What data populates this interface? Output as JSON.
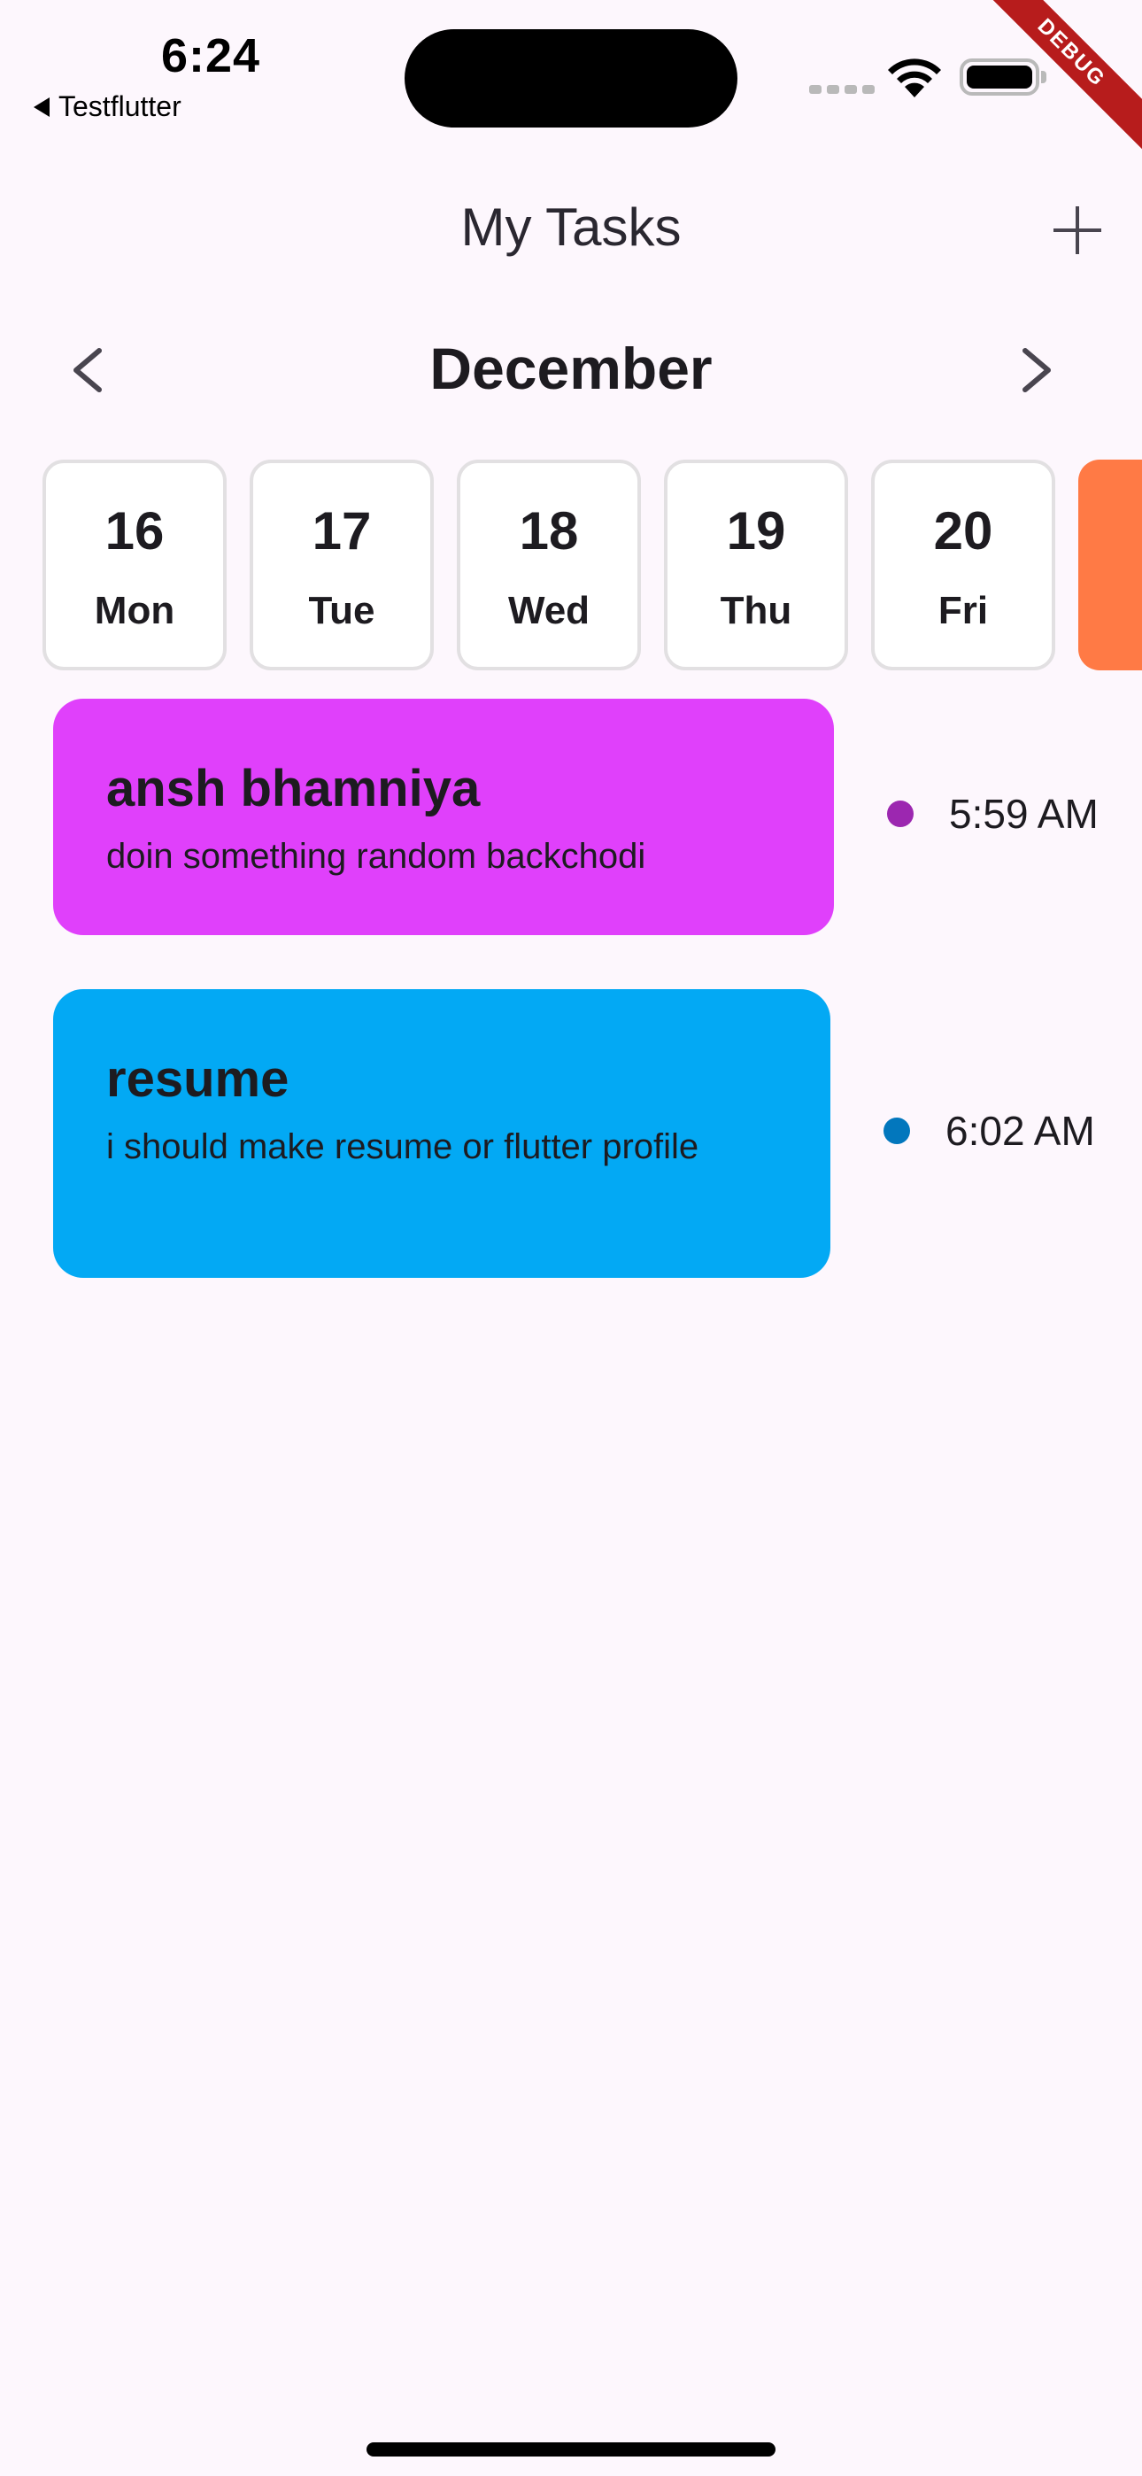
{
  "status_bar": {
    "time": "6:24",
    "back_app": "Testflutter",
    "debug_label": "DEBUG"
  },
  "header": {
    "title": "My Tasks",
    "add_icon": "plus-icon"
  },
  "calendar": {
    "month": "December",
    "prev_icon": "chevron-left-icon",
    "next_icon": "chevron-right-icon",
    "days": [
      {
        "num": "16",
        "dow": "Mon"
      },
      {
        "num": "17",
        "dow": "Tue"
      },
      {
        "num": "18",
        "dow": "Wed"
      },
      {
        "num": "19",
        "dow": "Thu"
      },
      {
        "num": "20",
        "dow": "Fri"
      }
    ],
    "selected_color": "#ff7a45"
  },
  "tasks": [
    {
      "title": "ansh bhamniya",
      "description": "doin something random backchodi",
      "time": "5:59 AM",
      "card_color": "#e040fb",
      "dot_color": "#9c27b0"
    },
    {
      "title": "resume",
      "description": "i should make resume or flutter profile",
      "time": "6:02 AM",
      "card_color": "#03a9f4",
      "dot_color": "#0277bd"
    }
  ]
}
